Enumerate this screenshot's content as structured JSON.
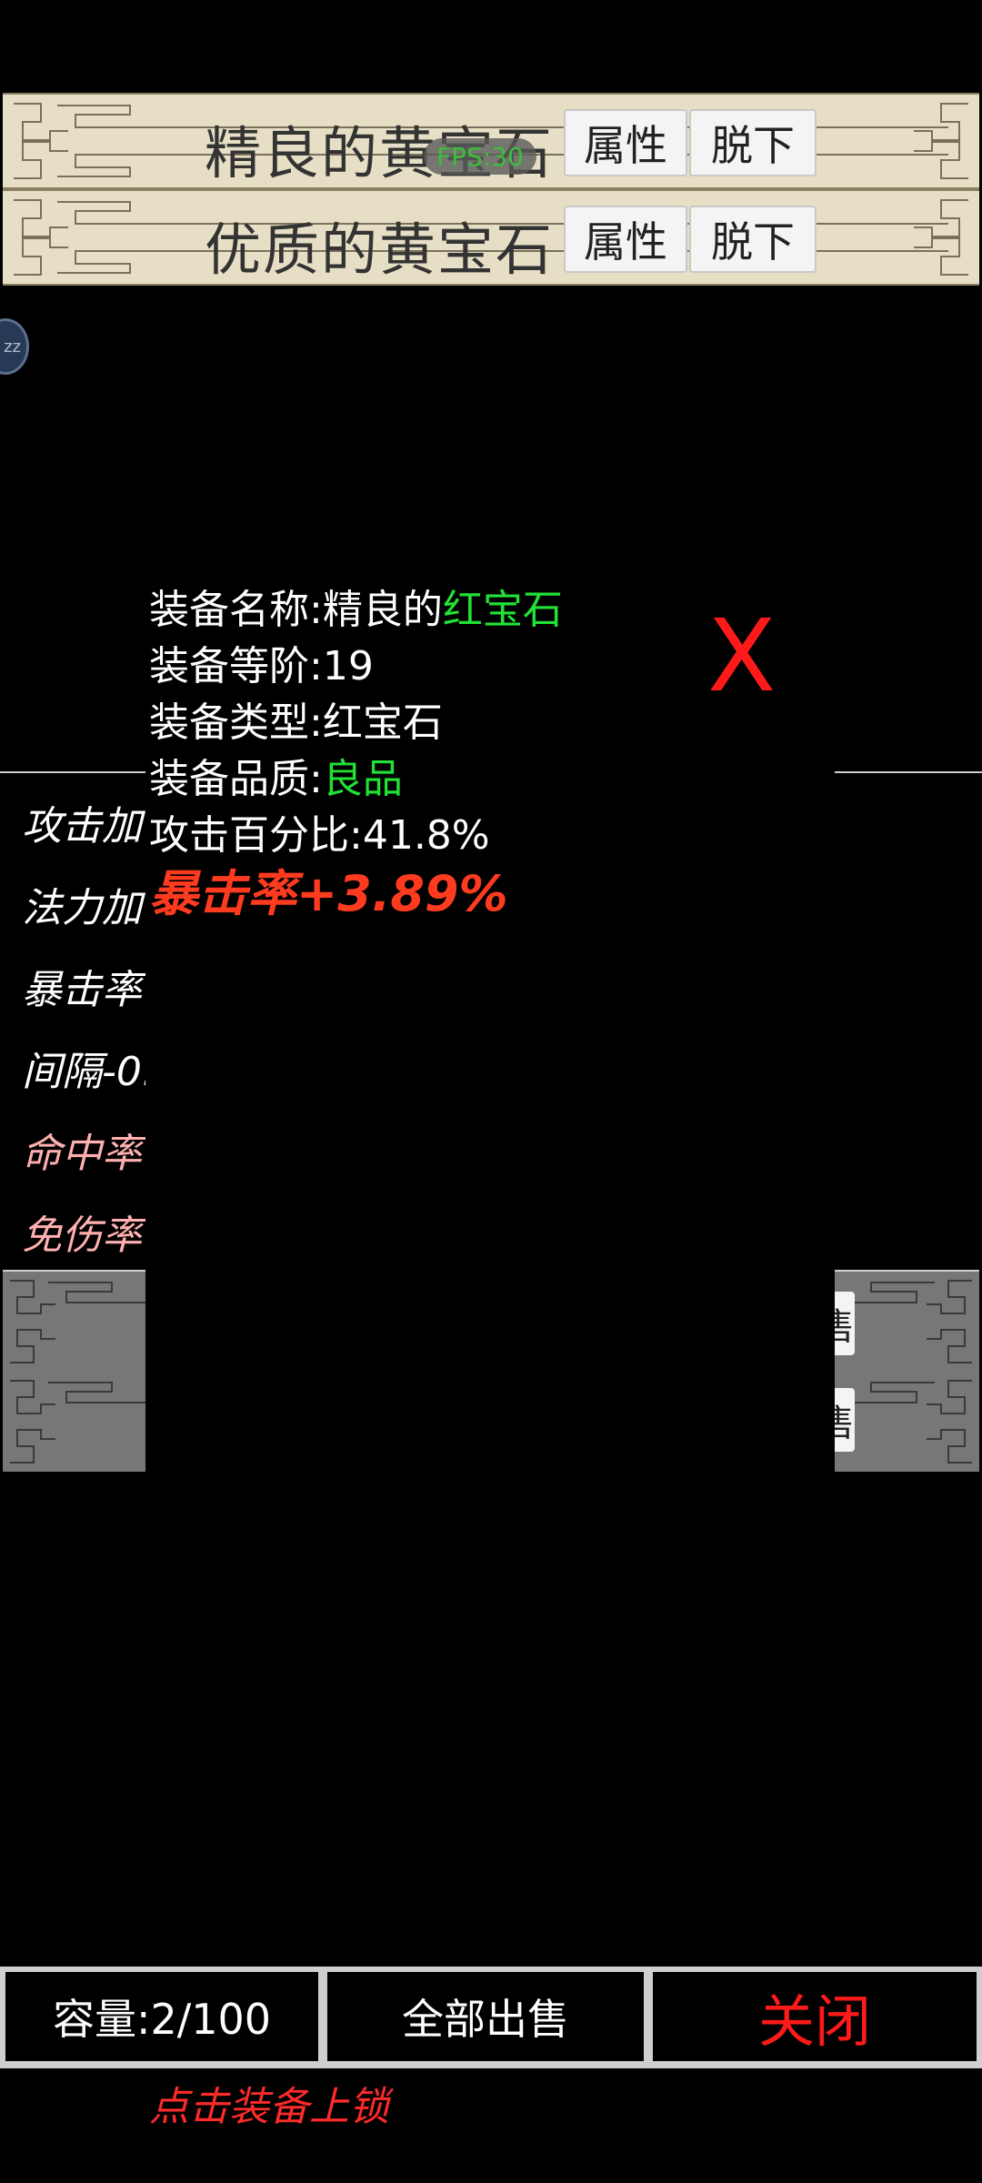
{
  "equipped": [
    {
      "name": "精良的黄宝石",
      "attr_label": "属性",
      "remove_label": "脱下"
    },
    {
      "name": "优质的黄宝石",
      "attr_label": "属性",
      "remove_label": "脱下"
    }
  ],
  "fps_badge": "FPS:30",
  "floating_bubble": "zz",
  "stat_list": [
    {
      "text": "攻击加",
      "color": "#ffffff"
    },
    {
      "text": "法力加",
      "color": "#ffffff"
    },
    {
      "text": "暴击率",
      "color": "#ffffff"
    },
    {
      "text": "间隔-0.",
      "color": "#ffffff"
    },
    {
      "text": "命中率",
      "color": "#ffb0b0"
    },
    {
      "text": "免伤率",
      "color": "#ffb0b0"
    }
  ],
  "side_buttons": [
    "售",
    "售"
  ],
  "detail": {
    "name_label": "装备名称:精良的",
    "name_value": "红宝石",
    "tier_label": "装备等阶:",
    "tier_value": "19",
    "type_label": "装备类型:",
    "type_value": "红宝石",
    "quality_label": "装备品质:",
    "quality_value": "良品",
    "attack_label": "攻击百分比:",
    "attack_value": "41.8%",
    "crit_text": "暴击率+3.89%",
    "close_label": "X"
  },
  "colors": {
    "highlight_green": "#22e236",
    "crit_red": "#ff3b1f",
    "close_red": "#ff1a1a",
    "panel_beige": "#e6dfc5"
  },
  "bottom_bar": {
    "capacity_label": "容量:2/100",
    "sell_all_label": "全部出售",
    "close_label": "关闭"
  },
  "hint": "点击装备上锁"
}
